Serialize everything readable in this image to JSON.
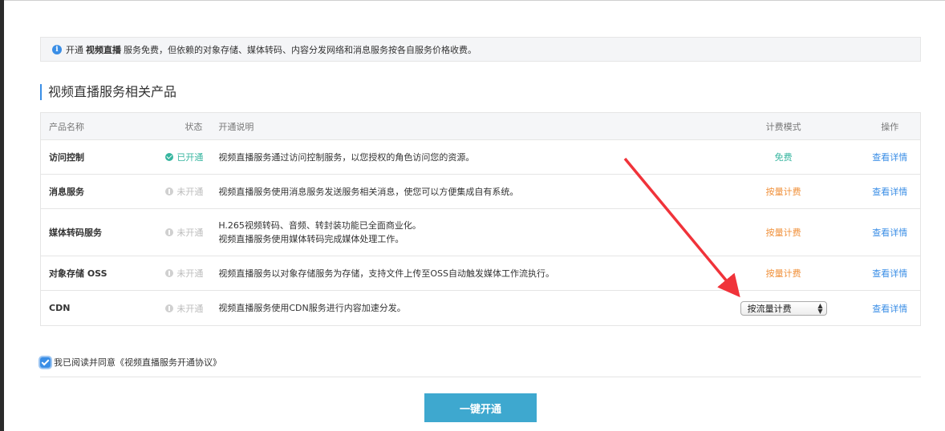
{
  "notice": {
    "prefix": "开通",
    "service": "视频直播",
    "suffix": "服务免费，但依赖的对象存储、媒体转码、内容分发网络和消息服务按各自服务价格收费。"
  },
  "section_title": "视频直播服务相关产品",
  "table": {
    "headers": {
      "name": "产品名称",
      "status": "状态",
      "desc": "开通说明",
      "billing": "计费模式",
      "op": "操作"
    },
    "rows": [
      {
        "name": "访问控制",
        "status": "已开通",
        "desc": [
          "视频直播服务通过访问控制服务，以您授权的角色访问您的资源。"
        ],
        "billing": "免费",
        "op": "查看详情"
      },
      {
        "name": "消息服务",
        "status": "未开通",
        "desc": [
          "视频直播服务使用消息服务发送服务相关消息，使您可以方便集成自有系统。"
        ],
        "billing": "按量计费",
        "op": "查看详情"
      },
      {
        "name": "媒体转码服务",
        "status": "未开通",
        "desc": [
          "H.265视频转码、音频、转封装功能已全面商业化。",
          "视频直播服务使用媒体转码完成媒体处理工作。"
        ],
        "billing": "按量计费",
        "op": "查看详情"
      },
      {
        "name": "对象存储 OSS",
        "status": "未开通",
        "desc": [
          "视频直播服务以对象存储服务为存储，支持文件上传至OSS自动触发媒体工作流执行。"
        ],
        "billing": "按量计费",
        "op": "查看详情"
      },
      {
        "name": "CDN",
        "status": "未开通",
        "desc": [
          "视频直播服务使用CDN服务进行内容加速分发。"
        ],
        "billing_select": "按流量计费",
        "op": "查看详情"
      }
    ]
  },
  "agreement": {
    "text": "我已阅读并同意",
    "link": "《视频直播服务开通协议》",
    "checked": true
  },
  "submit_label": "一键开通",
  "colors": {
    "accent": "#3a8ee6",
    "button": "#3ea8cf",
    "enabled": "#36b59f",
    "paid": "#f0903a",
    "arrow": "#f0333a"
  }
}
